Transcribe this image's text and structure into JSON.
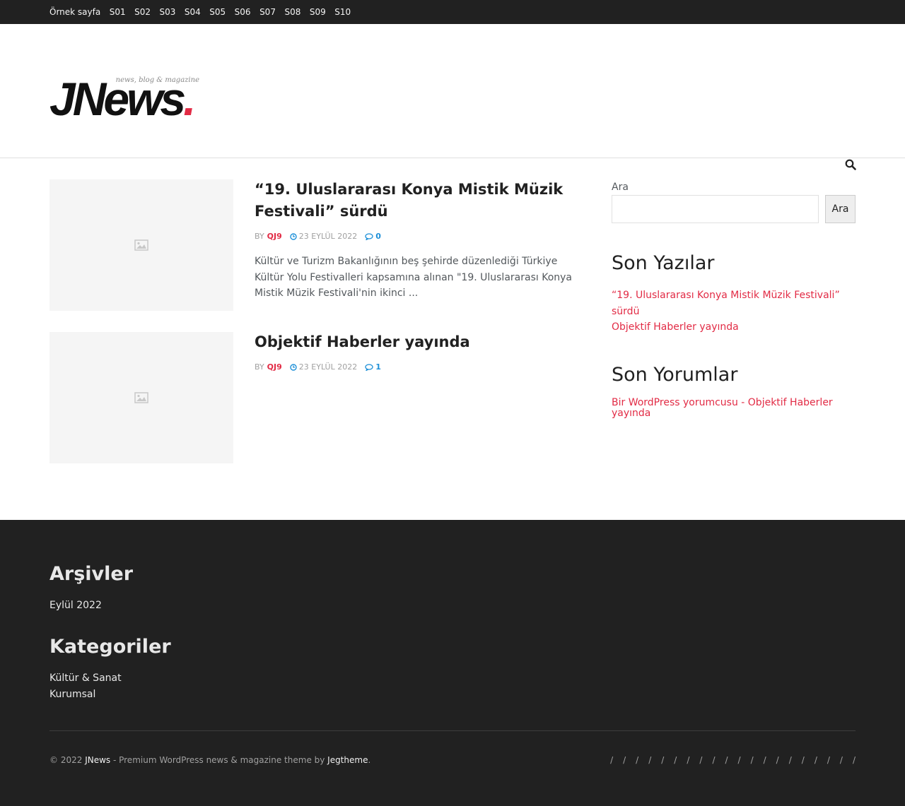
{
  "topbar": {
    "menu": [
      "Örnek sayfa",
      "S01",
      "S02",
      "S03",
      "S04",
      "S05",
      "S06",
      "S07",
      "S08",
      "S09",
      "S10"
    ]
  },
  "logo": {
    "tagline": "news, blog & magazine",
    "wordmark": "JNews",
    "dot": "."
  },
  "icons": {
    "search": "search-icon",
    "image_placeholder": "image-icon",
    "clock": "clock-icon",
    "comment": "comment-icon"
  },
  "colors": {
    "accent": "#e22b45",
    "topbar_bg": "#212121",
    "footer_bg": "#212121",
    "comment_blue": "#1e90d8"
  },
  "posts": [
    {
      "title": "“19. Uluslararası Konya Mistik Müzik Festivali” sürdü",
      "by": "BY",
      "author": "QJ9",
      "date": "23 EYLÜL 2022",
      "comments": "0",
      "excerpt": "Kültür ve Turizm Bakanlığının beş şehirde düzenlediği Türkiye Kültür Yolu Festivalleri kapsamına alınan \"19. Uluslararası Konya Mistik Müzik Festivali'nin ikinci ..."
    },
    {
      "title": "Objektif Haberler yayında",
      "by": "BY",
      "author": "QJ9",
      "date": "23 EYLÜL 2022",
      "comments": "1",
      "excerpt": ""
    }
  ],
  "sidebar": {
    "search_label": "Ara",
    "search_placeholder": "",
    "search_button": "Ara",
    "recent_posts_title": "Son Yazılar",
    "recent_posts": [
      "“19. Uluslararası Konya Mistik Müzik Festivali” sürdü",
      "Objektif Haberler yayında"
    ],
    "recent_comments_title": "Son Yorumlar",
    "recent_comment": "Bir WordPress yorumcusu - Objektif Haberler yayında"
  },
  "footer": {
    "archives_title": "Arşivler",
    "archives": [
      "Eylül 2022"
    ],
    "categories_title": "Kategoriler",
    "categories": [
      "Kültür & Sanat",
      "Kurumsal"
    ],
    "copyright_prefix": "© 2022",
    "copyright_brand": "JNews",
    "copyright_middle": " - Premium WordPress news & magazine theme by ",
    "copyright_author": "Jegtheme",
    "copyright_suffix": ".",
    "menu_separators": [
      "/",
      "/",
      "/",
      "/",
      "/",
      "/",
      "/",
      "/",
      "/",
      "/",
      "/",
      "/",
      "/",
      "/",
      "/",
      "/",
      "/",
      "/",
      "/",
      "/"
    ]
  }
}
